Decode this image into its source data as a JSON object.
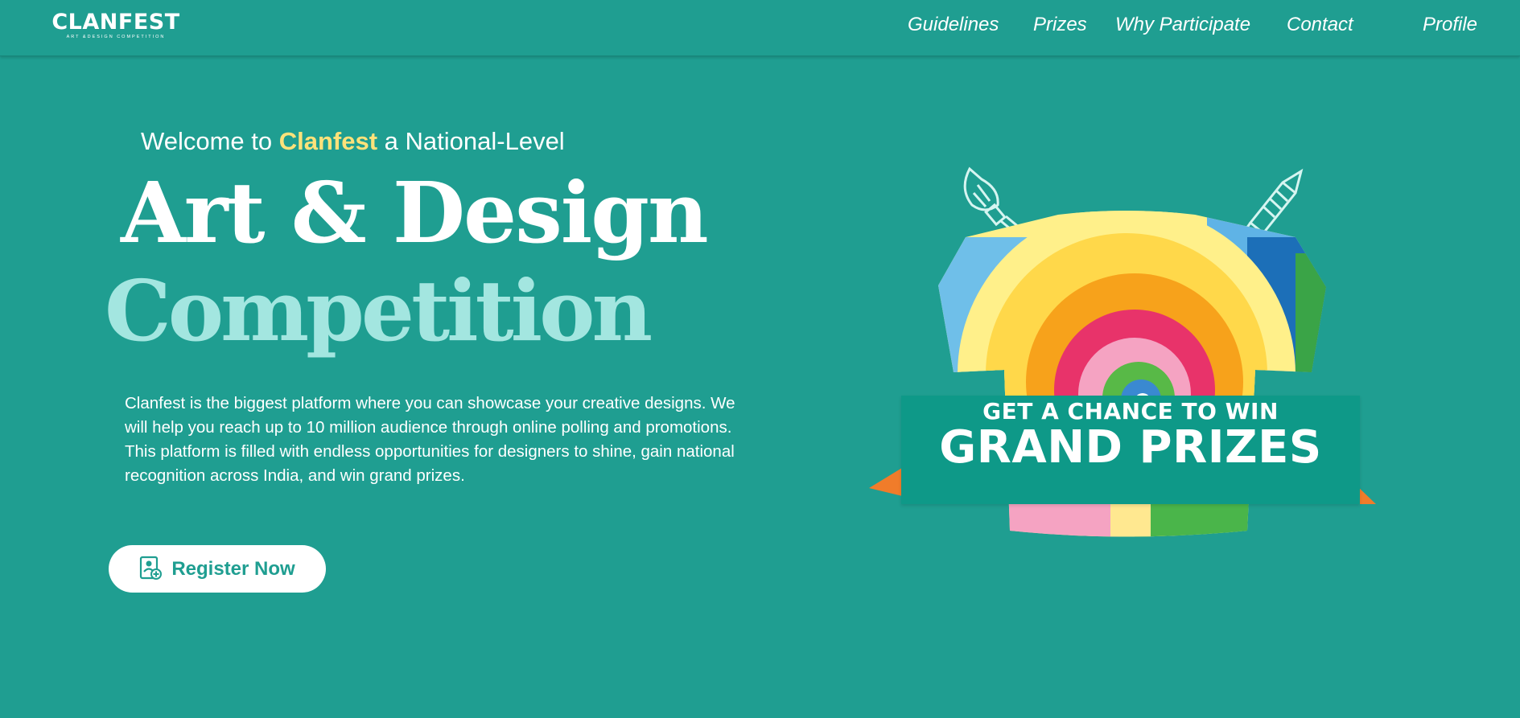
{
  "nav": {
    "logo_title": "CLANFEST",
    "logo_subtitle": "ART &DESIGN COMPETITION",
    "links": [
      "Guidelines",
      "Prizes",
      "Why Participate",
      "Contact"
    ],
    "profile": "Profile"
  },
  "hero": {
    "welcome_prefix": "Welcome to",
    "welcome_brand": "Clanfest",
    "welcome_suffix": "a National-Level",
    "headline_line1": "Art & Design",
    "headline_line2": "Competition",
    "description": "Clanfest is the biggest platform where you can showcase your creative designs. We will help you reach up to 10 million audience through online polling and promotions. This platform is filled with endless opportunities for designers to shine, gain national recognition across India, and win grand prizes.",
    "register_label": "Register Now",
    "register_icon": "user-register-icon"
  },
  "promo": {
    "line1": "GET A CHANCE TO WIN",
    "line2": "GRAND PRIZES",
    "icons": [
      "paintbrush-icon",
      "pencil-icon",
      "tie-dye-tshirt-illustration"
    ]
  },
  "colors": {
    "background": "#1f9e91",
    "brand_highlight": "#ffe27a",
    "headline_light": "#a3e6e0",
    "banner": "#0e9988",
    "ribbon_accent": "#f07c2a"
  }
}
